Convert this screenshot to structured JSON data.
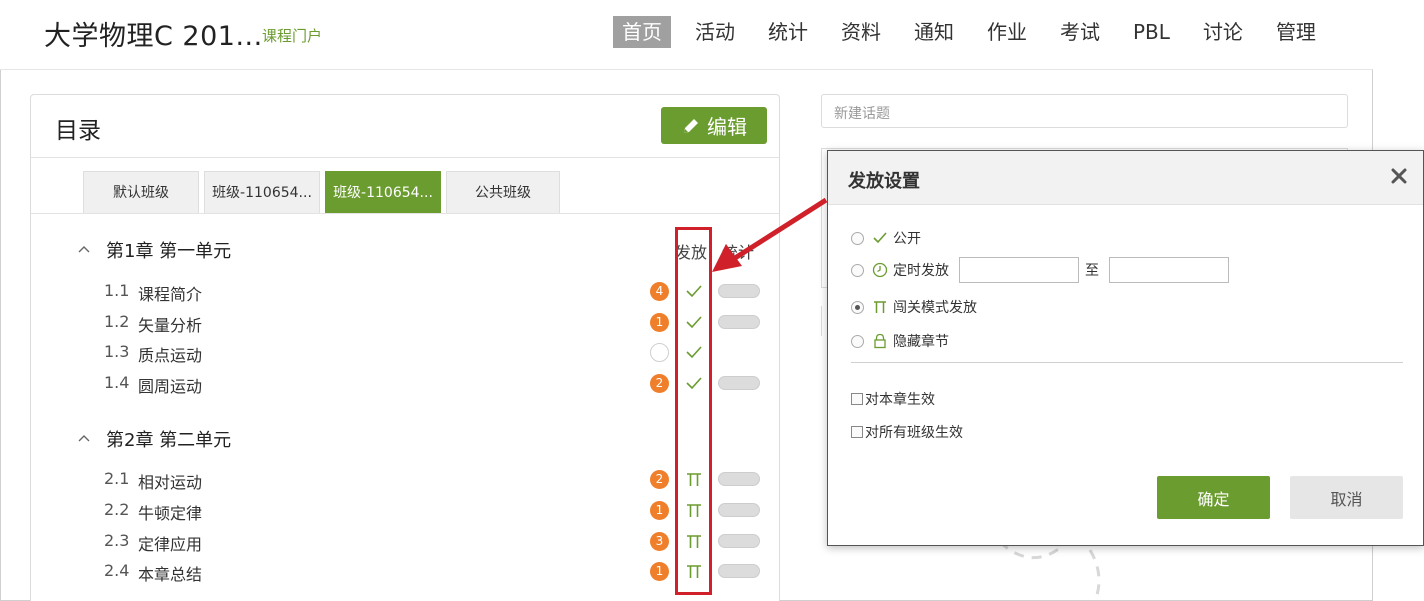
{
  "header": {
    "course_title": "大学物理C  201...",
    "portal_link": "课程门户",
    "nav": [
      "首页",
      "活动",
      "统计",
      "资料",
      "通知",
      "作业",
      "考试",
      "PBL",
      "讨论",
      "管理"
    ],
    "active_nav": "首页"
  },
  "catalog": {
    "title": "目录",
    "edit_label": "编辑",
    "tabs": [
      "默认班级",
      "班级-110654...",
      "班级-110654...",
      "公共班级"
    ],
    "active_tab_index": 2,
    "col_release": "发放",
    "col_stats": "统计",
    "chapters": [
      {
        "title": "第1章 第一单元",
        "sections": [
          {
            "num": "1.1",
            "name": "课程简介",
            "badge": "4",
            "status": "check",
            "has_stats": true
          },
          {
            "num": "1.2",
            "name": "矢量分析",
            "badge": "1",
            "status": "check",
            "has_stats": true
          },
          {
            "num": "1.3",
            "name": "质点运动",
            "badge": "",
            "status": "check",
            "has_stats": false
          },
          {
            "num": "1.4",
            "name": "圆周运动",
            "badge": "2",
            "status": "check",
            "has_stats": true
          }
        ]
      },
      {
        "title": "第2章 第二单元",
        "sections": [
          {
            "num": "2.1",
            "name": "相对运动",
            "badge": "2",
            "status": "gate",
            "has_stats": true
          },
          {
            "num": "2.2",
            "name": "牛顿定律",
            "badge": "1",
            "status": "gate",
            "has_stats": true
          },
          {
            "num": "2.3",
            "name": "定律应用",
            "badge": "3",
            "status": "gate",
            "has_stats": true
          },
          {
            "num": "2.4",
            "name": "本章总结",
            "badge": "1",
            "status": "gate",
            "has_stats": true
          }
        ]
      }
    ]
  },
  "sidebar": {
    "new_topic_placeholder": "新建话题"
  },
  "dialog": {
    "title": "发放设置",
    "options": {
      "public": "公开",
      "timed": "定时发放",
      "to": "至",
      "gate": "闯关模式发放",
      "hidden": "隐藏章节"
    },
    "selected_option": "gate",
    "check_chapter": "对本章生效",
    "check_all_classes": "对所有班级生效",
    "ok_label": "确定",
    "cancel_label": "取消"
  },
  "colors": {
    "accent_green": "#6b9c2f",
    "badge_orange": "#ef7f2b",
    "highlight_red": "#d0202a"
  }
}
